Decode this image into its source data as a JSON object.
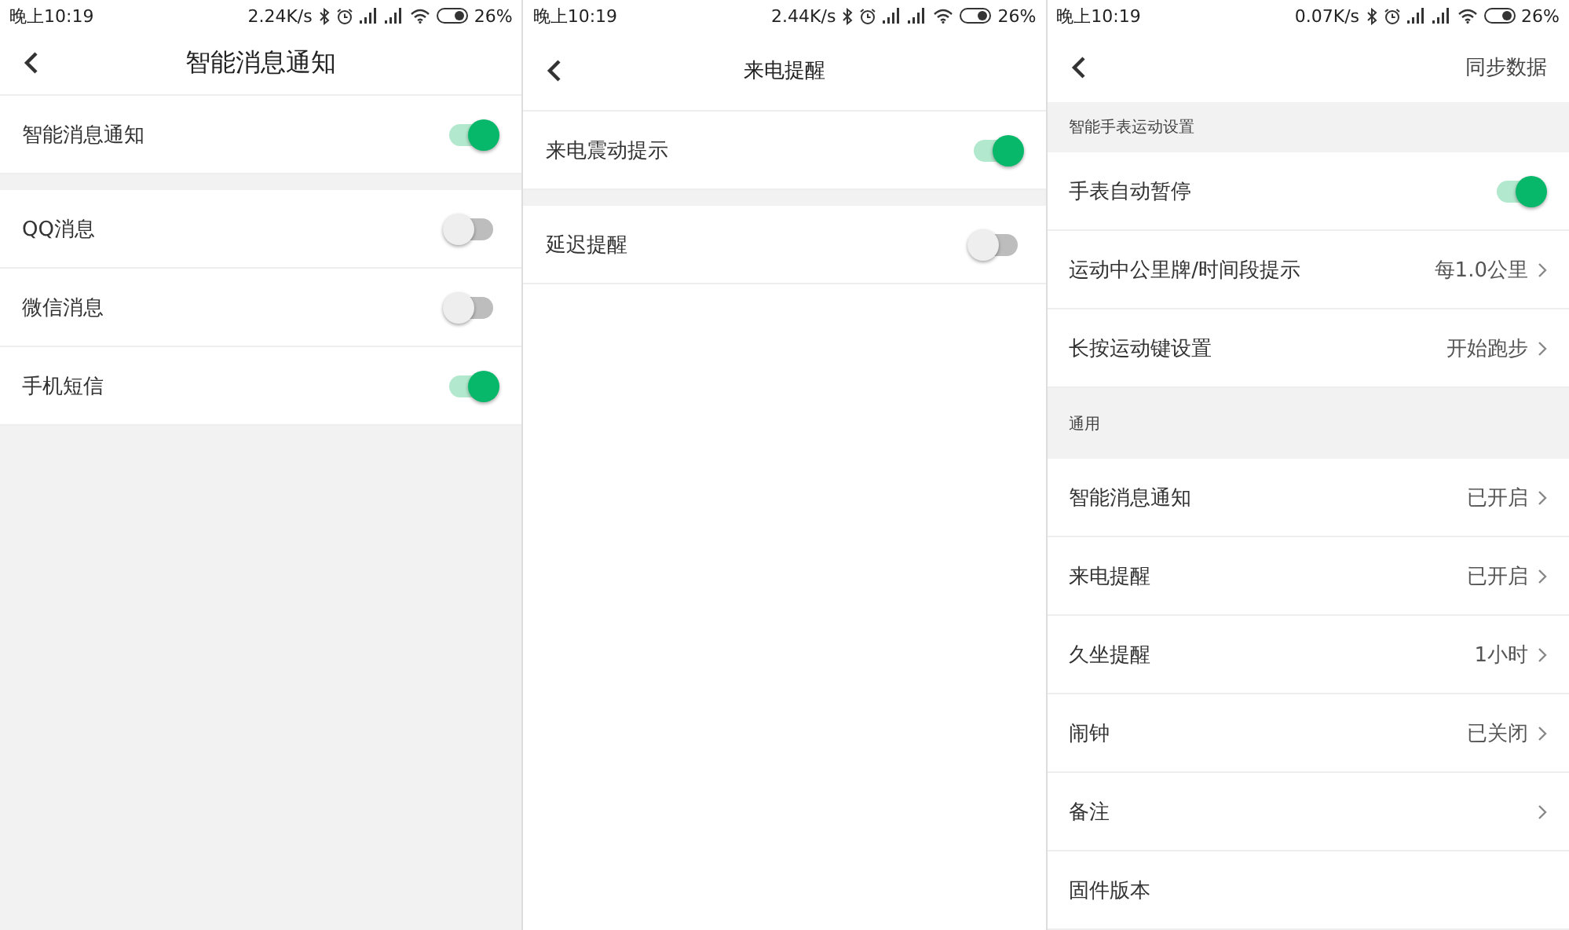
{
  "screens": [
    {
      "status_bar": {
        "time": "晚上10:19",
        "speed": "2.24K/s",
        "battery": "26%"
      },
      "header": {
        "title": "智能消息通知"
      },
      "items": [
        {
          "kind": "toggle",
          "label": "智能消息通知",
          "on": true
        },
        {
          "kind": "spacer"
        },
        {
          "kind": "toggle",
          "label": "QQ消息",
          "on": false
        },
        {
          "kind": "toggle",
          "label": "微信消息",
          "on": false
        },
        {
          "kind": "toggle",
          "label": "手机短信",
          "on": true
        }
      ]
    },
    {
      "status_bar": {
        "time": "晚上10:19",
        "speed": "2.44K/s",
        "battery": "26%"
      },
      "header": {
        "title": "来电提醒"
      },
      "items": [
        {
          "kind": "toggle",
          "label": "来电震动提示",
          "on": true
        },
        {
          "kind": "spacer"
        },
        {
          "kind": "toggle",
          "label": "延迟提醒",
          "on": false
        }
      ]
    },
    {
      "status_bar": {
        "time": "晚上10:19",
        "speed": "0.07K/s",
        "battery": "26%"
      },
      "header": {
        "action": "同步数据"
      },
      "items": [
        {
          "kind": "section",
          "label": "智能手表运动设置"
        },
        {
          "kind": "toggle",
          "label": "手表自动暂停",
          "on": true
        },
        {
          "kind": "link",
          "label": "运动中公里牌/时间段提示",
          "value": "每1.0公里"
        },
        {
          "kind": "link",
          "label": "长按运动键设置",
          "value": "开始跑步"
        },
        {
          "kind": "section",
          "label": "通用"
        },
        {
          "kind": "link",
          "label": "智能消息通知",
          "value": "已开启"
        },
        {
          "kind": "link",
          "label": "来电提醒",
          "value": "已开启"
        },
        {
          "kind": "link",
          "label": "久坐提醒",
          "value": "1小时"
        },
        {
          "kind": "link",
          "label": "闹钟",
          "value": "已关闭"
        },
        {
          "kind": "link",
          "label": "备注"
        },
        {
          "kind": "link",
          "label": "固件版本"
        }
      ]
    }
  ]
}
